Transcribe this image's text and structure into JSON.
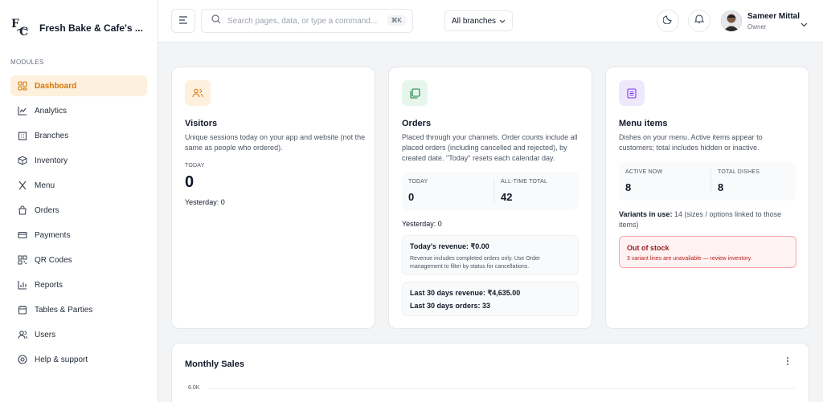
{
  "brand": {
    "name": "Fresh Bake & Cafe's ..."
  },
  "sidebar": {
    "section_label": "MODULES",
    "items": [
      {
        "label": "Dashboard",
        "icon": "dashboard-icon"
      },
      {
        "label": "Analytics",
        "icon": "analytics-icon"
      },
      {
        "label": "Branches",
        "icon": "branches-icon"
      },
      {
        "label": "Inventory",
        "icon": "inventory-icon"
      },
      {
        "label": "Menu",
        "icon": "menu-icon"
      },
      {
        "label": "Orders",
        "icon": "orders-icon"
      },
      {
        "label": "Payments",
        "icon": "payments-icon"
      },
      {
        "label": "QR Codes",
        "icon": "qr-code-icon"
      },
      {
        "label": "Reports",
        "icon": "reports-icon"
      },
      {
        "label": "Tables & Parties",
        "icon": "tables-icon"
      },
      {
        "label": "Users",
        "icon": "users-icon"
      },
      {
        "label": "Help & support",
        "icon": "help-icon"
      }
    ],
    "active_index": 0
  },
  "topbar": {
    "search_placeholder": "Search pages, data, or type a command...",
    "search_shortcut": "⌘K",
    "branch_select": "All branches",
    "user_name": "Sameer Mittal",
    "user_role": "Owner"
  },
  "visitors": {
    "title": "Visitors",
    "description": "Unique sessions today on your app and website (not the same as people who ordered).",
    "today_label": "TODAY",
    "today_value": "0",
    "yesterday": "Yesterday: 0"
  },
  "orders": {
    "title": "Orders",
    "description": "Placed through your channels. Order counts include all placed orders (including cancelled and rejected), by created date. \"Today\" resets each calendar day.",
    "today_label": "TODAY",
    "today_value": "0",
    "alltime_label": "ALL-TIME TOTAL",
    "alltime_value": "42",
    "yesterday": "Yesterday: 0",
    "revenue_today": "Today's revenue: ₹0.00",
    "revenue_note": "Revenue includes completed orders only. Use Order management to filter by status for cancellations.",
    "last30_revenue": "Last 30 days revenue: ₹4,635.00",
    "last30_orders": "Last 30 days orders: 33"
  },
  "menu_items": {
    "title": "Menu items",
    "description": "Dishes on your menu. Active items appear to customers; total includes hidden or inactive.",
    "active_label": "ACTIVE NOW",
    "active_value": "8",
    "total_label": "TOTAL DISHES",
    "total_value": "8",
    "variants_label": "Variants in use:",
    "variants_text": "14 (sizes / options linked to those items)",
    "alert_title": "Out of stock",
    "alert_text": "3 variant lines are unavailable — review inventory."
  },
  "monthly_sales": {
    "title": "Monthly Sales",
    "y_tick": "6.0K"
  },
  "colors": {
    "accent": "#d97706",
    "active_bg": "#fdf0dc",
    "visitors_icon_bg": "#fdf0dc",
    "orders_icon_bg": "#e6f6ec",
    "menu_icon_bg": "#efe7fb",
    "alert_red": "#b91c1c"
  }
}
